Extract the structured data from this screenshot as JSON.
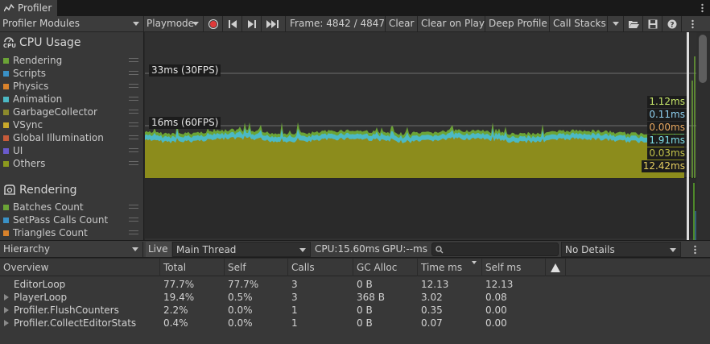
{
  "window": {
    "tab_title": "Profiler"
  },
  "toolbar": {
    "modules_label": "Profiler Modules",
    "playmode_label": "Playmode",
    "frame_label": "Frame: 4842 / 4847",
    "clear_label": "Clear",
    "clear_on_play_label": "Clear on Play",
    "deep_profile_label": "Deep Profile",
    "call_stacks_label": "Call Stacks"
  },
  "cpu": {
    "title": "CPU Usage",
    "legend": [
      {
        "label": "Rendering",
        "color": "#6ba336"
      },
      {
        "label": "Scripts",
        "color": "#3a91c6"
      },
      {
        "label": "Physics",
        "color": "#d9822b"
      },
      {
        "label": "Animation",
        "color": "#4cb9c4"
      },
      {
        "label": "GarbageCollector",
        "color": "#8c8a2c"
      },
      {
        "label": "VSync",
        "color": "#c9a82a"
      },
      {
        "label": "Global Illumination",
        "color": "#c75b3a"
      },
      {
        "label": "UI",
        "color": "#6a5acd"
      },
      {
        "label": "Others",
        "color": "#8c9a1e"
      }
    ],
    "grid_30fps": "33ms (30FPS)",
    "grid_60fps": "16ms (60FPS)",
    "values": [
      "1.12ms",
      "0.11ms",
      "0.00ms",
      "1.91ms",
      "0.03ms",
      "12.42ms"
    ],
    "value_colors": [
      "#c8e86a",
      "#8fd0f0",
      "#e8a860",
      "#7fe0e8",
      "#c4c44a",
      "#e8d060"
    ]
  },
  "rendering": {
    "title": "Rendering",
    "legend": [
      {
        "label": "Batches Count",
        "color": "#6ba336"
      },
      {
        "label": "SetPass Calls Count",
        "color": "#3a91c6"
      },
      {
        "label": "Triangles Count",
        "color": "#d9822b"
      }
    ]
  },
  "bottom": {
    "view_label": "Hierarchy",
    "live_label": "Live",
    "thread_label": "Main Thread",
    "cpu_label": "CPU:15.60ms",
    "gpu_label": "GPU:--ms",
    "details_label": "No Details"
  },
  "table": {
    "columns": [
      "Overview",
      "Total",
      "Self",
      "Calls",
      "GC Alloc",
      "Time ms",
      "Self ms"
    ],
    "rows": [
      {
        "name": "EditorLoop",
        "expandable": false,
        "values": [
          "77.7%",
          "77.7%",
          "3",
          "0 B",
          "12.13",
          "12.13"
        ]
      },
      {
        "name": "PlayerLoop",
        "expandable": true,
        "values": [
          "19.4%",
          "0.5%",
          "3",
          "368 B",
          "3.02",
          "0.08"
        ]
      },
      {
        "name": "Profiler.FlushCounters",
        "expandable": true,
        "values": [
          "2.2%",
          "0.0%",
          "1",
          "0 B",
          "0.35",
          "0.00"
        ]
      },
      {
        "name": "Profiler.CollectEditorStats",
        "expandable": true,
        "values": [
          "0.4%",
          "0.0%",
          "1",
          "0 B",
          "0.07",
          "0.00"
        ]
      }
    ]
  }
}
